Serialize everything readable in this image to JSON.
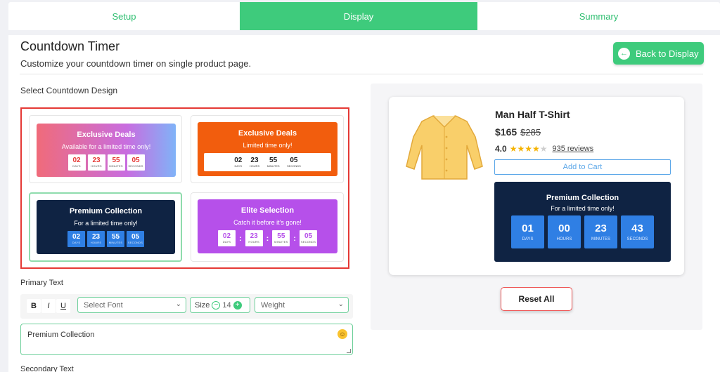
{
  "tabs": [
    {
      "label": "Setup"
    },
    {
      "label": "Display"
    },
    {
      "label": "Summary"
    }
  ],
  "header": {
    "title": "Countdown Timer",
    "subtitle": "Customize your countdown timer on single product page.",
    "back_button": "Back to Display"
  },
  "designs": {
    "label": "Select Countdown Design",
    "cards": [
      {
        "heading": "Exclusive Deals",
        "sub": "Available for a limited time only!",
        "units": [
          [
            "02",
            "DAYS"
          ],
          [
            "23",
            "HOURS"
          ],
          [
            "55",
            "MINUTES"
          ],
          [
            "05",
            "SECONDS"
          ]
        ]
      },
      {
        "heading": "Exclusive Deals",
        "sub": "Limited time only!",
        "units": [
          [
            "02",
            "DAYS"
          ],
          [
            "23",
            "HOURS"
          ],
          [
            "55",
            "MINUTES"
          ],
          [
            "05",
            "SECONDS"
          ]
        ]
      },
      {
        "heading": "Premium Collection",
        "sub": "For a limited time only!",
        "units": [
          [
            "02",
            "DAYS"
          ],
          [
            "23",
            "HOURS"
          ],
          [
            "55",
            "MINUTES"
          ],
          [
            "05",
            "SECONDS"
          ]
        ]
      },
      {
        "heading": "Elite Selection",
        "sub": "Catch it before it's gone!",
        "units": [
          [
            "02",
            "DAYS"
          ],
          [
            "23",
            "HOURS"
          ],
          [
            "55",
            "MINUTES"
          ],
          [
            "05",
            "SECONDS"
          ]
        ]
      }
    ],
    "selected_index": 2
  },
  "primary_text": {
    "label": "Primary Text",
    "bold": "B",
    "italic": "I",
    "underline": "U",
    "font_placeholder": "Select Font",
    "size_label": "Size",
    "size_value": "14",
    "weight_placeholder": "Weight",
    "value": "Premium Collection"
  },
  "secondary_text": {
    "label": "Secondary Text"
  },
  "preview": {
    "product_name": "Man Half T-Shirt",
    "price": "$165",
    "old_price": "$285",
    "rating": "4.0",
    "stars": 4,
    "reviews": "935 reviews",
    "cart_button": "Add to Cart",
    "timer": {
      "heading": "Premium Collection",
      "sub": "For a limited time only!",
      "units": [
        [
          "01",
          "DAYS"
        ],
        [
          "00",
          "HOURS"
        ],
        [
          "23",
          "MINUTES"
        ],
        [
          "43",
          "SECONDS"
        ]
      ]
    }
  },
  "reset_button": "Reset All",
  "colors": {
    "accent": "#3ecb7c",
    "navy": "#0f2343",
    "blue": "#2f7fe4",
    "orange": "#f25d0d",
    "purple": "#b650ea",
    "danger": "#e53935"
  }
}
